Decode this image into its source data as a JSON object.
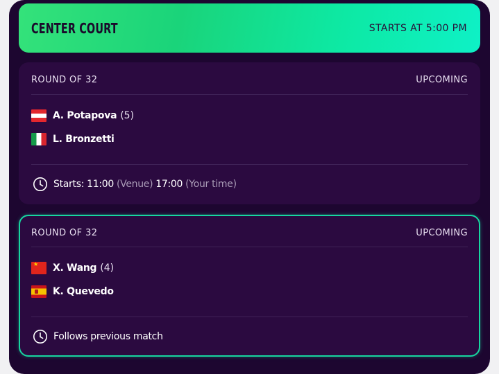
{
  "court": {
    "title": "CENTER COURT",
    "start": "STARTS AT 5:00 PM"
  },
  "matches": [
    {
      "round": "ROUND OF 32",
      "status": "UPCOMING",
      "players": [
        {
          "name": "A. Potapova",
          "seed": "(5)",
          "flag": "austria-flag-icon"
        },
        {
          "name": "L. Bronzetti",
          "seed": "",
          "flag": "italy-flag-icon"
        }
      ],
      "time": {
        "prefix": "Starts:",
        "venue_time": "11:00",
        "venue_label": "(Venue)",
        "your_time": "17:00",
        "your_label": "(Your time)"
      }
    },
    {
      "round": "ROUND OF 32",
      "status": "UPCOMING",
      "players": [
        {
          "name": "X. Wang",
          "seed": "(4)",
          "flag": "china-flag-icon"
        },
        {
          "name": "K. Quevedo",
          "seed": "",
          "flag": "spain-flag-icon"
        }
      ],
      "time": {
        "text": "Follows previous match"
      }
    }
  ],
  "colors": {
    "background": "#1d0630",
    "card": "#2b0a40",
    "accent_border": "#17d6a0",
    "header_gradient_start": "#34e27a",
    "header_gradient_end": "#0ef1c6"
  }
}
